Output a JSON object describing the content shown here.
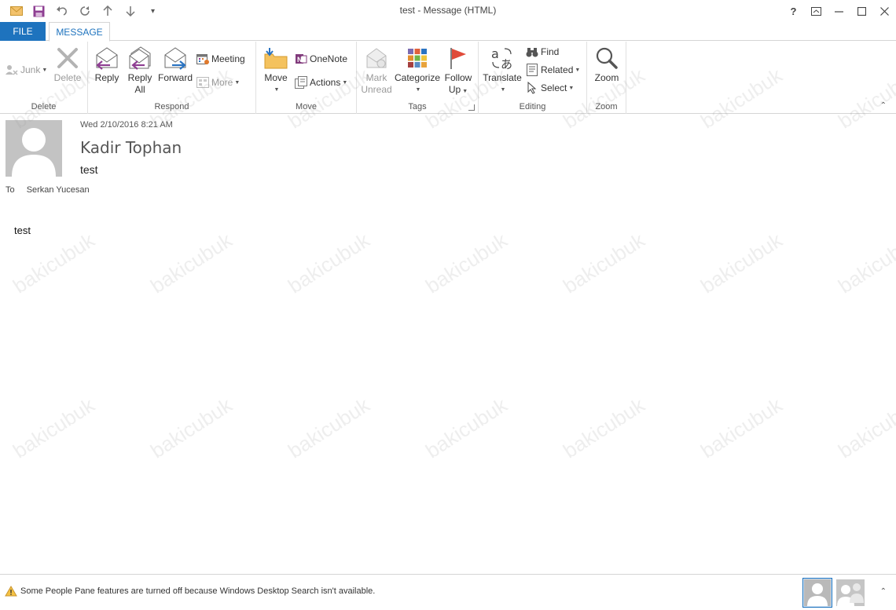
{
  "window": {
    "title": "test - Message (HTML)",
    "controls": {
      "help": "?",
      "restore_ribbon": "⊡",
      "minimize": "—",
      "maximize": "☐",
      "close": "✕"
    }
  },
  "qat": {
    "customize": "▾"
  },
  "tabs": {
    "file": "FILE",
    "message": "MESSAGE"
  },
  "ribbon": {
    "delete_group": {
      "label": "Delete",
      "junk": "Junk",
      "delete": "Delete"
    },
    "respond_group": {
      "label": "Respond",
      "reply": "Reply",
      "reply_all_1": "Reply",
      "reply_all_2": "All",
      "forward": "Forward",
      "meeting": "Meeting",
      "more": "More"
    },
    "move_group": {
      "label": "Move",
      "move": "Move",
      "onenote": "OneNote",
      "actions": "Actions"
    },
    "tags_group": {
      "label": "Tags",
      "mark_unread_1": "Mark",
      "mark_unread_2": "Unread",
      "categorize": "Categorize",
      "follow_up_1": "Follow",
      "follow_up_2": "Up"
    },
    "editing_group": {
      "label": "Editing",
      "translate": "Translate",
      "find": "Find",
      "related": "Related",
      "select": "Select"
    },
    "zoom_group": {
      "label": "Zoom",
      "zoom": "Zoom"
    },
    "collapse": "⌃"
  },
  "message": {
    "date": "Wed 2/10/2016 8:21 AM",
    "sender": "Kadir Tophan",
    "subject": "test",
    "to_label": "To",
    "to_value": "Serkan Yucesan",
    "body": "test"
  },
  "watermark": "bakicubuk",
  "statusbar": {
    "message": "Some People Pane features are turned off because Windows Desktop Search isn't available.",
    "collapse": "⌃"
  },
  "colors": {
    "accent": "#1e73be",
    "file_tab": "#1e73be"
  }
}
